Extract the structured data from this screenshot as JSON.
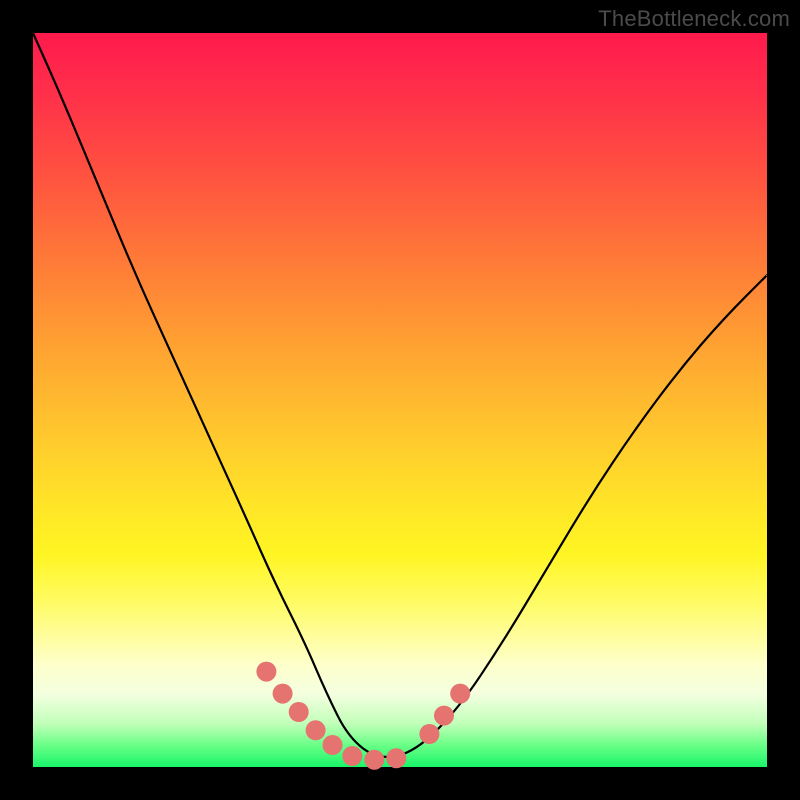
{
  "watermark": "TheBottleneck.com",
  "colors": {
    "background": "#000000",
    "curve_stroke": "#000000",
    "marker_fill": "#e5736f",
    "marker_stroke": "#d65e5a"
  },
  "chart_data": {
    "type": "line",
    "title": "",
    "xlabel": "",
    "ylabel": "",
    "xlim": [
      0,
      1
    ],
    "ylim": [
      0,
      1
    ],
    "grid": false,
    "legend": false,
    "note": "No numeric axis labels or tick marks are rendered; values below are normalized 0–1 estimates read from the plot geometry (0,0 = bottom-left of the gradient area, 1,1 = top-right).",
    "series": [
      {
        "name": "curve",
        "x": [
          0.0,
          0.04,
          0.09,
          0.14,
          0.19,
          0.24,
          0.29,
          0.33,
          0.37,
          0.4,
          0.43,
          0.47,
          0.52,
          0.58,
          0.64,
          0.7,
          0.76,
          0.82,
          0.88,
          0.94,
          1.0
        ],
        "y": [
          1.0,
          0.91,
          0.79,
          0.67,
          0.56,
          0.45,
          0.34,
          0.25,
          0.17,
          0.1,
          0.04,
          0.01,
          0.02,
          0.08,
          0.17,
          0.27,
          0.37,
          0.46,
          0.54,
          0.61,
          0.67
        ]
      }
    ],
    "markers": {
      "name": "highlight-dots",
      "x": [
        0.318,
        0.34,
        0.362,
        0.385,
        0.408,
        0.435,
        0.465,
        0.495,
        0.54,
        0.56,
        0.582
      ],
      "y": [
        0.13,
        0.1,
        0.075,
        0.05,
        0.03,
        0.015,
        0.01,
        0.012,
        0.045,
        0.07,
        0.1
      ]
    }
  }
}
